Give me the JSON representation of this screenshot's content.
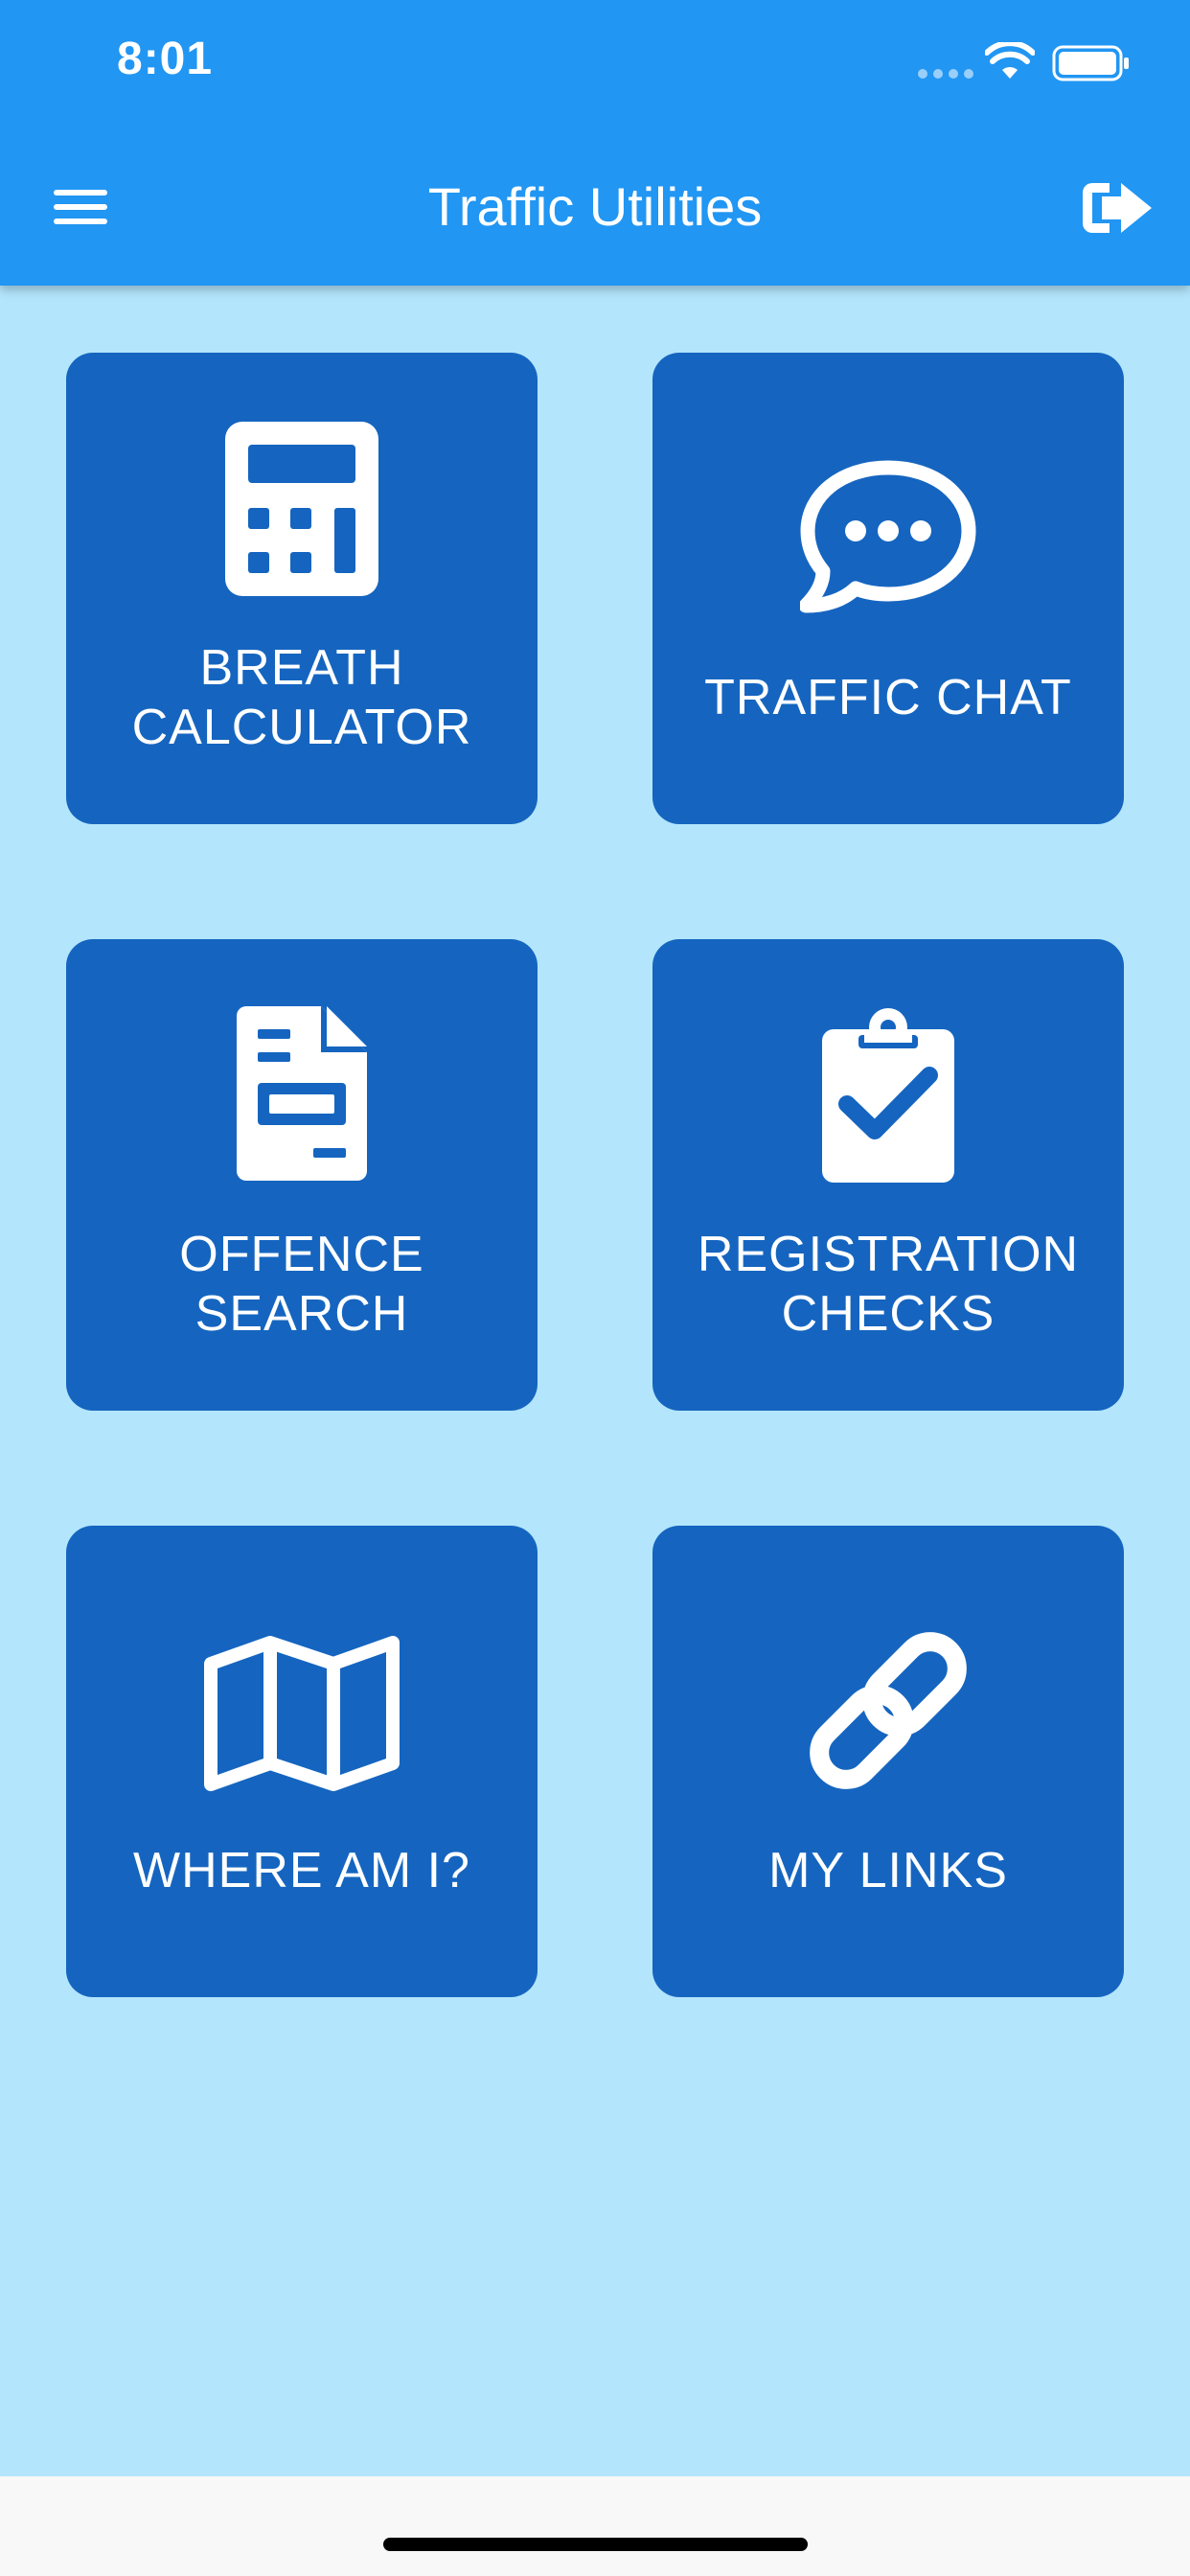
{
  "status_bar": {
    "time": "8:01"
  },
  "app_bar": {
    "title": "Traffic Utilities",
    "menu_icon": "hamburger-menu-icon",
    "logout_icon": "sign-out-icon"
  },
  "tiles": [
    {
      "label": "BREATH\nCALCULATOR",
      "icon": "calculator-icon"
    },
    {
      "label": "TRAFFIC CHAT",
      "icon": "chat-bubble-icon"
    },
    {
      "label": "OFFENCE\nSEARCH",
      "icon": "document-icon"
    },
    {
      "label": "REGISTRATION\nCHECKS",
      "icon": "clipboard-check-icon"
    },
    {
      "label": "WHERE AM I?",
      "icon": "map-icon"
    },
    {
      "label": "MY LINKS",
      "icon": "link-icon"
    }
  ],
  "colors": {
    "app_bar": "#2196F3",
    "background": "#B3E5FC",
    "tile": "#1565C0",
    "text": "#FFFFFF"
  }
}
